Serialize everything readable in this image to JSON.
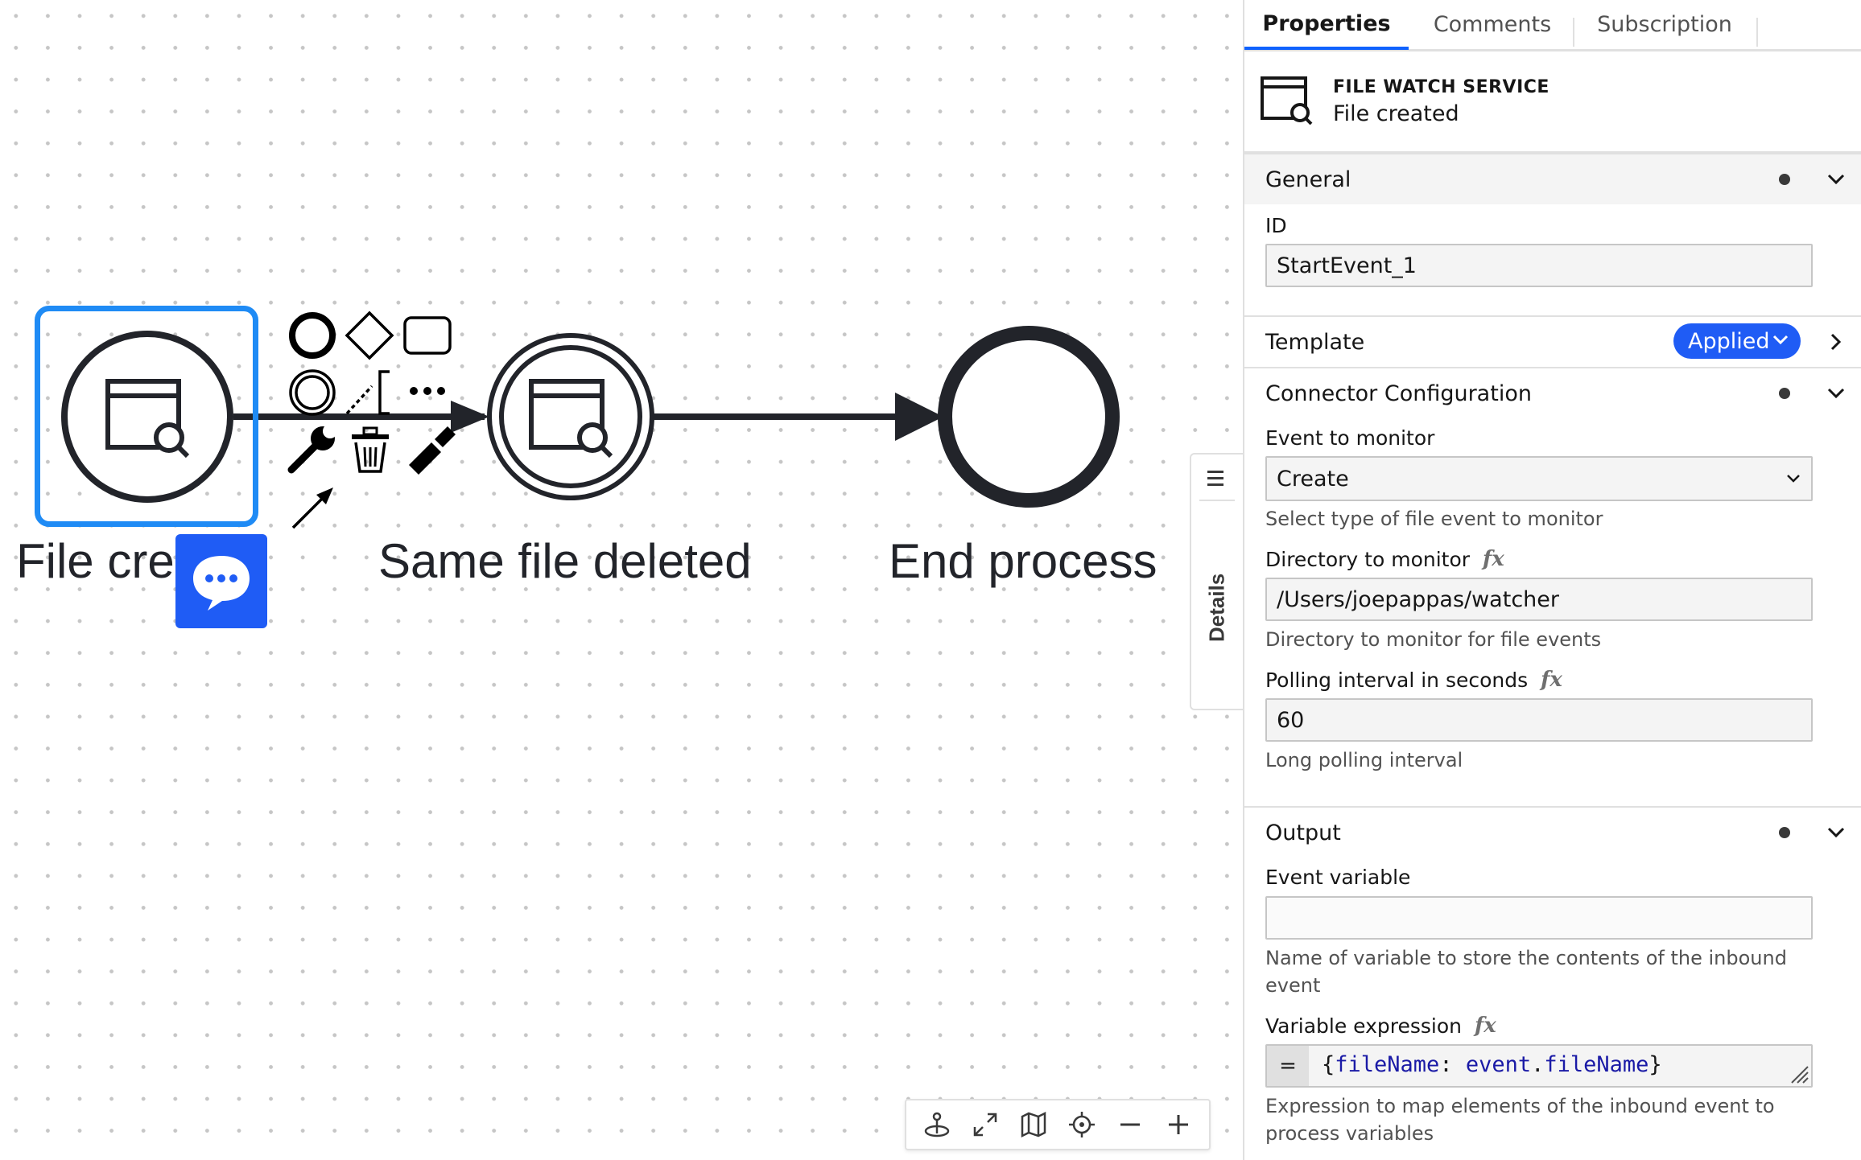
{
  "canvas": {
    "elements": [
      {
        "label": "File created",
        "type": "start-event",
        "selected": true
      },
      {
        "label": "Same file deleted",
        "type": "intermediate-catch-event"
      },
      {
        "label": "End process",
        "type": "end-event"
      }
    ],
    "context_pad_icons": [
      "start-event-icon",
      "gateway-icon",
      "task-icon",
      "intermediate-event-icon",
      "text-annotation-icon",
      "more-icon",
      "wrench-icon",
      "trash-icon",
      "color-brush-icon",
      "connect-arrow-icon"
    ],
    "comment_bubble_icon": "chat-bubble-icon",
    "details_tab": {
      "label": "Details",
      "icon": "list-icon"
    },
    "toolbar_icons": [
      "anchor-icon",
      "fullscreen-icon",
      "minimap-icon",
      "reset-view-icon",
      "zoom-out-icon",
      "zoom-in-icon"
    ],
    "selection_color": "#1f8bf5"
  },
  "panel": {
    "tabs": [
      {
        "label": "Properties",
        "active": true
      },
      {
        "label": "Comments",
        "active": false
      },
      {
        "label": "Subscription",
        "active": false
      }
    ],
    "element": {
      "type": "FILE WATCH SERVICE",
      "name": "File created",
      "icon": "file-watch-icon"
    },
    "groups": {
      "general": {
        "title": "General",
        "id_label": "ID",
        "id_value": "StartEvent_1"
      },
      "template": {
        "title": "Template",
        "badge": "Applied",
        "badge_color": "#1f5cf5"
      },
      "connector": {
        "title": "Connector Configuration",
        "event_label": "Event to monitor",
        "event_value": "Create",
        "event_desc": "Select type of file event to monitor",
        "dir_label": "Directory to monitor",
        "dir_value": "/Users/joepappas/watcher",
        "dir_desc": "Directory to monitor for file events",
        "poll_label": "Polling interval in seconds",
        "poll_value": "60",
        "poll_desc": "Long polling interval"
      },
      "output": {
        "title": "Output",
        "var_label": "Event variable",
        "var_value": "",
        "var_desc": "Name of variable to store the contents of the inbound event",
        "expr_label": "Variable expression",
        "expr_prefix": "=",
        "expr_tokens": [
          "{",
          "fileName",
          ": ",
          "event",
          ".",
          "fileName",
          "}"
        ],
        "expr_desc": "Expression to map elements of the inbound event to process variables"
      }
    },
    "fx_label": "fx",
    "accent": "#0f62fe"
  }
}
